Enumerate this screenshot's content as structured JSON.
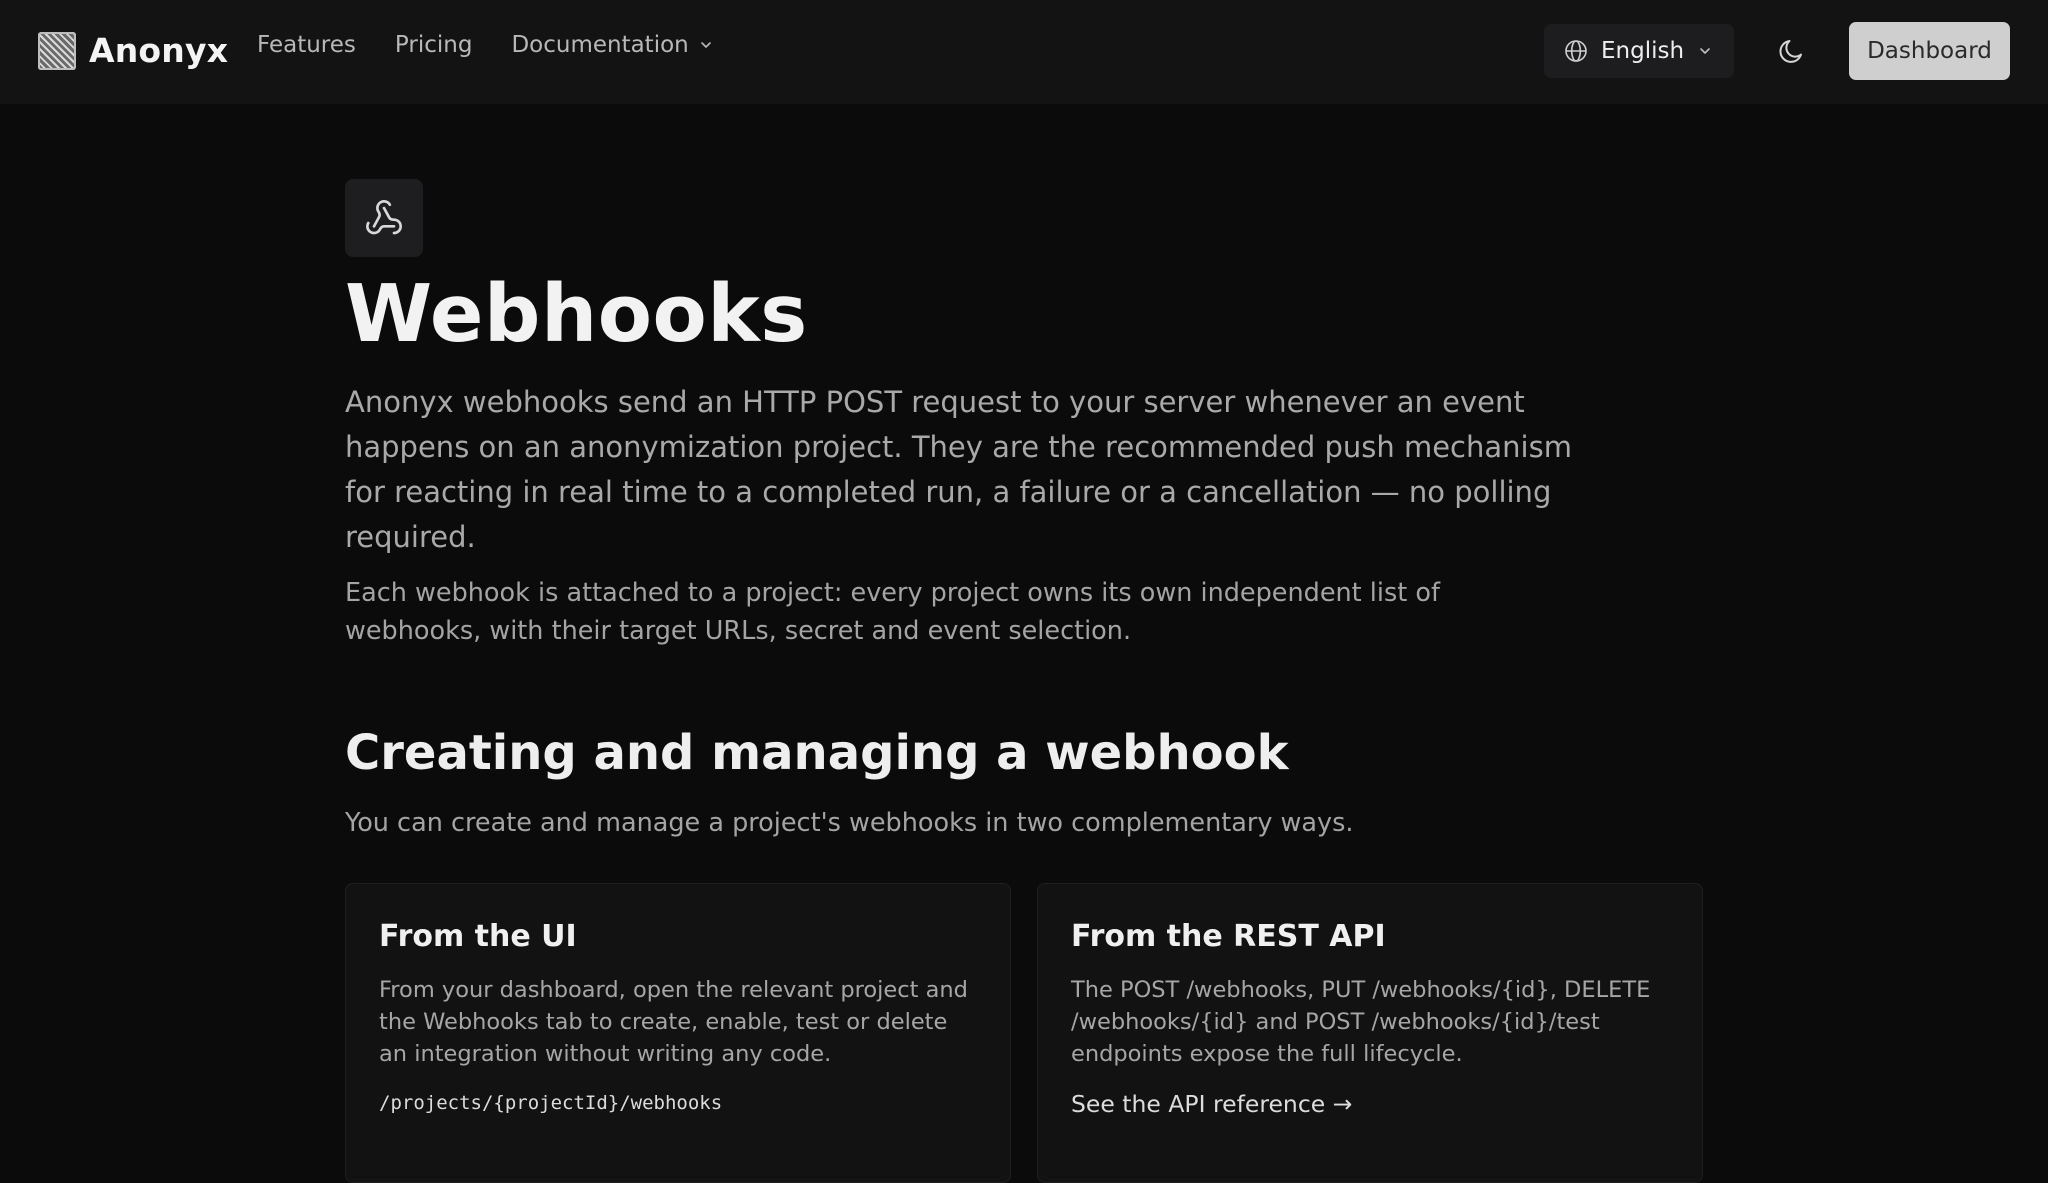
{
  "header": {
    "brand": "Anonyx",
    "nav": [
      {
        "label": "Features"
      },
      {
        "label": "Pricing"
      },
      {
        "label": "Documentation"
      }
    ],
    "language": "English",
    "dashboard_label": "Dashboard"
  },
  "icons": {
    "logo": "anonyx-logo-icon",
    "webhook": "webhook-icon",
    "globe": "globe-icon",
    "theme": "moon-icon",
    "chevron": "chevron-down-icon"
  },
  "colors": {
    "background": "#0b0b0c",
    "header": "#131314",
    "dashboard_button": "#cfcfcf",
    "muted_text": "#a9a9a9"
  },
  "main": {
    "title": "Webhooks",
    "lead": "Anonyx webhooks send an HTTP POST request to your server whenever an event happens on an anonymization project. They are the recommended push mechanism for reacting in real time to a completed run, a failure or a cancellation — no polling required.",
    "sub": "Each webhook is attached to a project: every project owns its own independent list of webhooks, with their target URLs, secret and event selection.",
    "section_title": "Creating and managing a webhook",
    "section_desc": "You can create and manage a project's webhooks in two complementary ways.",
    "cards": [
      {
        "title": "From the UI",
        "body": "From your dashboard, open the relevant project and the Webhooks tab to create, enable, test or delete an integration without writing any code.",
        "code": "/projects/{projectId}/webhooks"
      },
      {
        "title": "From the REST API",
        "body": "The POST /webhooks, PUT /webhooks/{id}, DELETE /webhooks/{id} and POST /webhooks/{id}/test endpoints expose the full lifecycle.",
        "link": "See the API reference →"
      }
    ]
  }
}
